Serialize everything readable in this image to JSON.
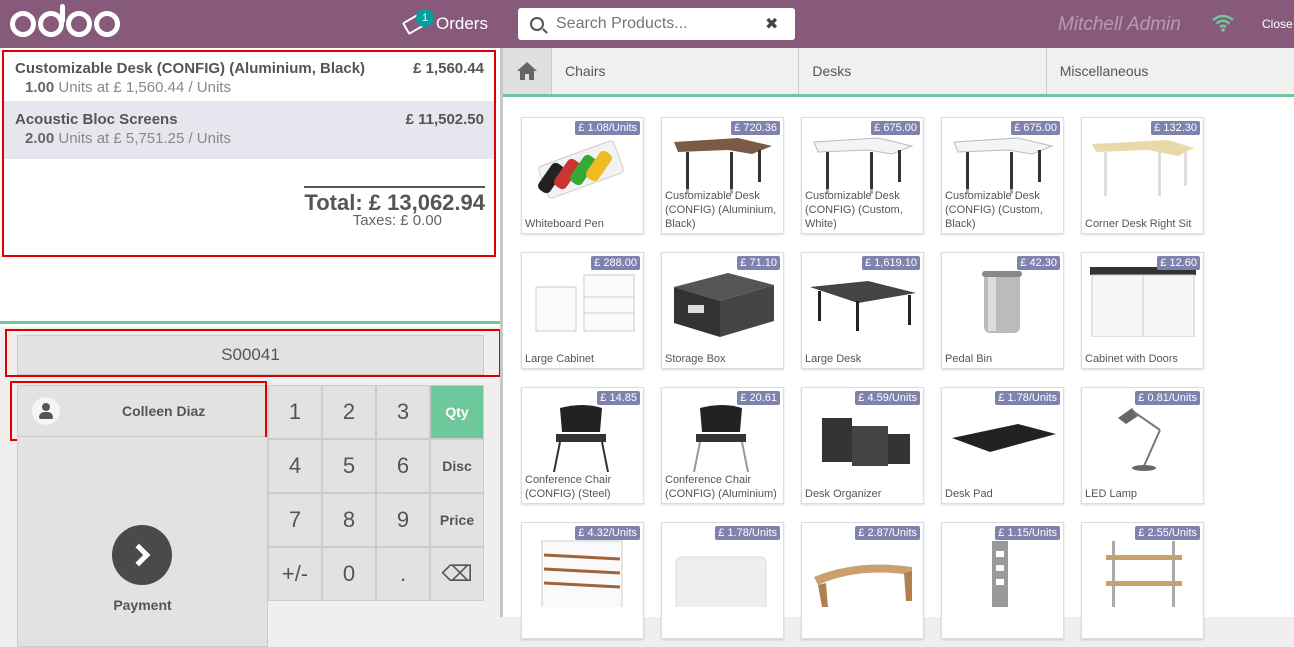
{
  "topbar": {
    "orders_label": "Orders",
    "orders_count": "1",
    "search_placeholder": "Search Products...",
    "user_name": "Mitchell Admin",
    "close_label": "Close"
  },
  "order": {
    "lines": [
      {
        "name": "Customizable Desk (CONFIG) (Aluminium, Black)",
        "price": "£ 1,560.44",
        "qty": "1.00",
        "info": "Units at £ 1,560.44 / Units"
      },
      {
        "name": "Acoustic Bloc Screens",
        "price": "£ 11,502.50",
        "qty": "2.00",
        "info": "Units at £ 5,751.25 / Units"
      }
    ],
    "total": "Total: £ 13,062.94",
    "taxes": "Taxes: £ 0.00"
  },
  "controls": {
    "reference": "S00041",
    "customer": "Colleen Diaz",
    "payment_label": "Payment",
    "keys": [
      "1",
      "2",
      "3",
      "Qty",
      "4",
      "5",
      "6",
      "Disc",
      "7",
      "8",
      "9",
      "Price",
      "+/-",
      "0",
      ".",
      "⌫"
    ]
  },
  "categories": [
    "Chairs",
    "Desks",
    "Miscellaneous"
  ],
  "products": [
    {
      "name": "Whiteboard Pen",
      "price": "£ 1.08/Units"
    },
    {
      "name": "Customizable Desk (CONFIG) (Aluminium, Black)",
      "price": "£ 720.36"
    },
    {
      "name": "Customizable Desk (CONFIG) (Custom, White)",
      "price": "£ 675.00"
    },
    {
      "name": "Customizable Desk (CONFIG) (Custom, Black)",
      "price": "£ 675.00"
    },
    {
      "name": "Corner Desk Right Sit",
      "price": "£ 132.30"
    },
    {
      "name": "Large Cabinet",
      "price": "£ 288.00"
    },
    {
      "name": "Storage Box",
      "price": "£ 71.10"
    },
    {
      "name": "Large Desk",
      "price": "£ 1,619.10"
    },
    {
      "name": "Pedal Bin",
      "price": "£ 42.30"
    },
    {
      "name": "Cabinet with Doors",
      "price": "£ 12.60"
    },
    {
      "name": "Conference Chair (CONFIG) (Steel)",
      "price": "£ 14.85"
    },
    {
      "name": "Conference Chair (CONFIG) (Aluminium)",
      "price": "£ 20.61"
    },
    {
      "name": "Desk Organizer",
      "price": "£ 4.59/Units"
    },
    {
      "name": "Desk Pad",
      "price": "£ 1.78/Units"
    },
    {
      "name": "LED Lamp",
      "price": "£ 0.81/Units"
    },
    {
      "name": "",
      "price": "£ 4.32/Units"
    },
    {
      "name": "",
      "price": "£ 1.78/Units"
    },
    {
      "name": "",
      "price": "£ 2.87/Units"
    },
    {
      "name": "",
      "price": "£ 1.15/Units"
    },
    {
      "name": "",
      "price": "£ 2.55/Units"
    }
  ],
  "colors": {
    "brand": "#875a7b",
    "accent": "#6ec89b",
    "price_tag": "#7f82ac"
  }
}
